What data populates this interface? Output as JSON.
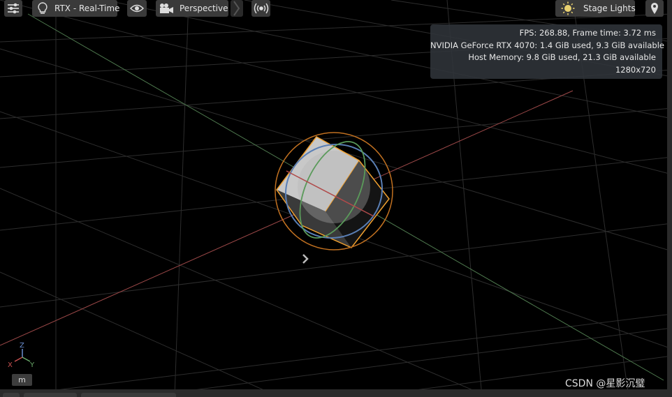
{
  "toolbar": {
    "renderer_label": "RTX - Real-Time",
    "camera_label": "Perspective",
    "lights_label": "Stage Lights",
    "icons": [
      "settings-sliders-icon",
      "lightbulb-icon",
      "eye-icon",
      "camera-icon",
      "chevron-double-icon",
      "broadcast-icon",
      "sun-icon",
      "map-pin-icon"
    ]
  },
  "stats": {
    "fps": "FPS: 268.88, Frame time: 3.72 ms",
    "gpu": "NVIDIA GeForce RTX 4070: 1.4 GiB used, 9.3 GiB available",
    "host_memory": "Host Memory: 9.8 GiB used, 21.3 GiB available",
    "resolution": "1280x720"
  },
  "axes": {
    "z": "Z",
    "x": "X",
    "y": "Y"
  },
  "unit_label": "m",
  "watermark": "CSDN @星影沉璧",
  "colors": {
    "x_axis": "#b05050",
    "y_axis": "#5f8f5f",
    "z_axis": "#5577bb",
    "selection": "#f0a030",
    "grid": "#2e2e2e"
  }
}
